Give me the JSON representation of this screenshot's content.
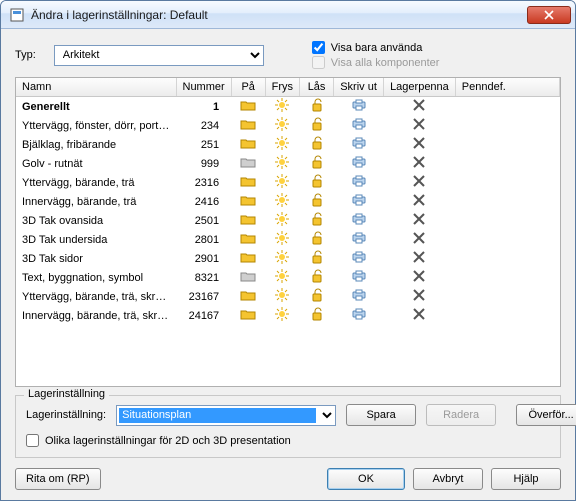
{
  "window": {
    "title": "Ändra i lagerinställningar: Default"
  },
  "top": {
    "typ_label": "Typ:",
    "typ_value": "Arkitekt",
    "cb_used": "Visa bara använda",
    "cb_used_checked": true,
    "cb_allcomp": "Visa alla komponenter",
    "cb_allcomp_checked": false
  },
  "columns": {
    "name": "Namn",
    "number": "Nummer",
    "on": "På",
    "freeze": "Frys",
    "lock": "Lås",
    "print": "Skriv ut",
    "pen": "Lagerpenna",
    "pendef": "Penndef."
  },
  "icons": {
    "folder_y": "📁",
    "folder_g": "📂",
    "sun": "☀",
    "lock": "🔓",
    "print": "🖶",
    "pen": "✖"
  },
  "rows": [
    {
      "name": "Generellt",
      "num": "1",
      "bold": true,
      "folder": "y"
    },
    {
      "name": "Yttervägg, fönster, dörr, port m.m.",
      "num": "234",
      "folder": "y"
    },
    {
      "name": "Bjälklag, fribärande",
      "num": "251",
      "folder": "y"
    },
    {
      "name": "Golv - rutnät",
      "num": "999",
      "folder": "g"
    },
    {
      "name": "Yttervägg, bärande, trä",
      "num": "2316",
      "folder": "y"
    },
    {
      "name": "Innervägg, bärande, trä",
      "num": "2416",
      "folder": "y"
    },
    {
      "name": "3D Tak ovansida",
      "num": "2501",
      "folder": "y"
    },
    {
      "name": "3D Tak undersida",
      "num": "2801",
      "folder": "y"
    },
    {
      "name": "3D Tak sidor",
      "num": "2901",
      "folder": "y"
    },
    {
      "name": "Text, byggnation, symbol",
      "num": "8321",
      "folder": "g"
    },
    {
      "name": "Yttervägg, bärande, trä, skravur...",
      "num": "23167",
      "folder": "y"
    },
    {
      "name": "Innervägg, bärande, trä, skravu...",
      "num": "24167",
      "folder": "y"
    }
  ],
  "group": {
    "legend": "Lagerinställning",
    "label": "Lagerinställning:",
    "value": "Situationsplan",
    "save": "Spara",
    "delete": "Radera",
    "transfer": "Överför...",
    "diff2d3d": "Olika lagerinställningar för 2D och 3D presentation",
    "diff2d3d_checked": false
  },
  "bottom": {
    "redraw": "Rita om (RP)",
    "ok": "OK",
    "cancel": "Avbryt",
    "help": "Hjälp"
  }
}
